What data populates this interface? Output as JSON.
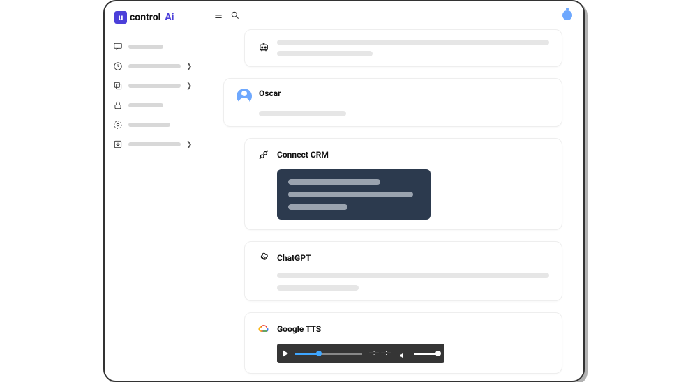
{
  "brand": {
    "mark": "u",
    "word": "control",
    "suffix": "Ai"
  },
  "sidebar": {
    "items": [
      {
        "id": "chat",
        "has_chevron": false
      },
      {
        "id": "history",
        "has_chevron": true
      },
      {
        "id": "files",
        "has_chevron": true
      },
      {
        "id": "security",
        "has_chevron": false
      },
      {
        "id": "settings",
        "has_chevron": false
      },
      {
        "id": "export",
        "has_chevron": true
      }
    ]
  },
  "feed": {
    "ai_message": {
      "lines": 2
    },
    "user_message": {
      "name": "Oscar"
    },
    "connect_card": {
      "title": "Connect CRM",
      "code_lines": 3
    },
    "gpt_card": {
      "title": "ChatGPT",
      "lines": 2
    },
    "tts_card": {
      "title": "Google TTS",
      "player": {
        "progress_pct": 35,
        "time_display": "--:--  --:--"
      }
    }
  }
}
